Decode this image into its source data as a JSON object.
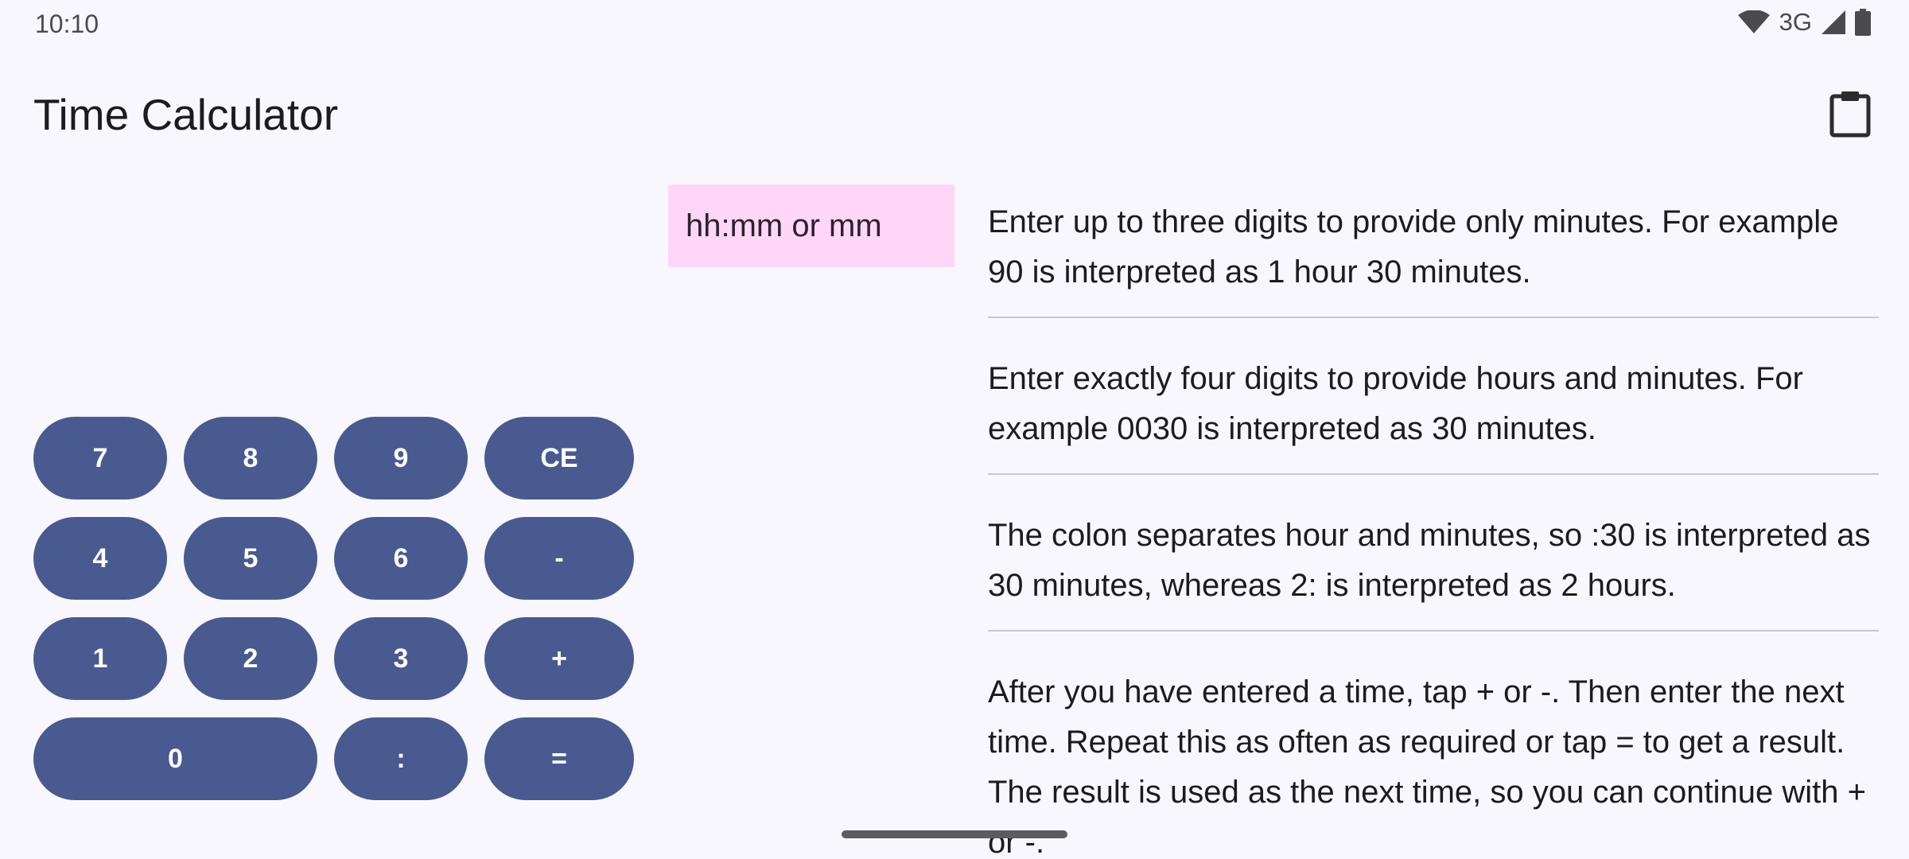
{
  "status_bar": {
    "time": "10:10",
    "network": "3G",
    "icons": [
      "wifi-icon",
      "cellular-signal-icon",
      "battery-icon"
    ]
  },
  "app_bar": {
    "title": "Time Calculator",
    "action_icon": "clipboard-icon"
  },
  "input": {
    "placeholder": "hh:mm or mm",
    "value": ""
  },
  "keypad": {
    "k7": "7",
    "k8": "8",
    "k9": "9",
    "ce": "CE",
    "k4": "4",
    "k5": "5",
    "k6": "6",
    "minus": "-",
    "k1": "1",
    "k2": "2",
    "k3": "3",
    "plus": "+",
    "k0": "0",
    "colon": ":",
    "equals": "="
  },
  "help": [
    "Enter up to three digits to provide only minutes. For example 90 is interpreted as 1 hour 30 minutes.",
    "Enter exactly four digits to provide hours and minutes. For example 0030 is interpreted as 30 minutes.",
    "The colon separates hour and minutes, so :30 is interpreted as 30 minutes, whereas 2: is interpreted as 2 hours.",
    "After you have entered a time, tap + or -. Then enter the next time. Repeat this as often as required or tap = to get a result. The result is used as the next time, so you can continue with + or -."
  ],
  "colors": {
    "background": "#f8f7fd",
    "key": "#485a8f",
    "key_text": "#ffffff",
    "input_background": "#ffd6f8",
    "divider": "#c8c6cf"
  }
}
